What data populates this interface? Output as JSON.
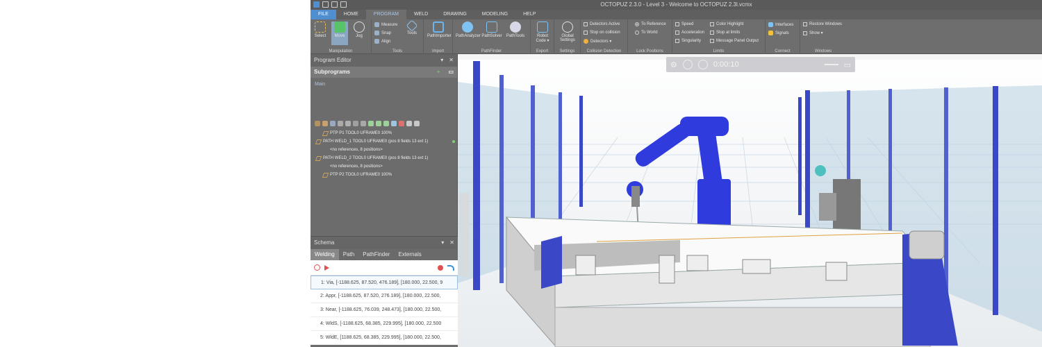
{
  "app": {
    "title": "OCTOPUZ 2.3.0 - Level 3 - Welcome to OCTOPUZ 2.3l.vcmx"
  },
  "menu": {
    "tabs": [
      "FILE",
      "HOME",
      "PROGRAM",
      "WELD",
      "DRAWING",
      "MODELING",
      "HELP"
    ],
    "active": "PROGRAM"
  },
  "ribbon": {
    "manipulation": {
      "label": "Manipulation",
      "select": "Select",
      "move": "Move",
      "jog": "Jog"
    },
    "tools": {
      "label": "Tools",
      "measure": "Measure",
      "snap": "Snap",
      "align": "Align",
      "tools": "Tools"
    },
    "import": {
      "label": "Import",
      "pathimporter": "PathImporter"
    },
    "pathfinder": {
      "label": "PathFinder",
      "analyzer": "PathAnalyzer",
      "solver": "PathSolver",
      "pathtools": "PathTools"
    },
    "export": {
      "label": "Export",
      "robotcode": "Robot Code ▾"
    },
    "settings": {
      "label": "Settings",
      "global": "Global Settings"
    },
    "collision": {
      "label": "Collision Detection",
      "active": "Detectors Active",
      "stop": "Stop on collision",
      "detectors": "Detectors ▾"
    },
    "lock": {
      "label": "Lock Positions",
      "toref": "To Reference",
      "toworld": "To World"
    },
    "limits": {
      "label": "Limits",
      "speed": "Speed",
      "accel": "Acceleration",
      "singular": "Singularity",
      "color": "Color Highlight",
      "stop": "Stop at limits",
      "msg": "Message Panel Output"
    },
    "connect": {
      "label": "Connect",
      "interfaces": "Interfaces",
      "signals": "Signals"
    },
    "windows": {
      "label": "Windows",
      "restore": "Restore Windows",
      "show": "Show ▾"
    }
  },
  "program_editor": {
    "title": "Program Editor",
    "subprograms": "Subprograms",
    "main": "Main",
    "tree": [
      {
        "text": "PTP P1 TOOL0 UFRAME0 100%",
        "indent": 1
      },
      {
        "text": "PATH WELD_1 TOOL0 UFRAME0 (pos 8 fields 13 ext 1)",
        "indent": 0,
        "dot": true
      },
      {
        "text": "<no references, 8 positions>",
        "indent": 2
      },
      {
        "text": "PATH WELD_2 TOOL0 UFRAME0 (pos 8 fields 13 ext 1)",
        "indent": 0
      },
      {
        "text": "<no references, 8 positions>",
        "indent": 2
      },
      {
        "text": "PTP P2 TOOL0 UFRAME0 100%",
        "indent": 1
      }
    ]
  },
  "schema": {
    "title": "Schema",
    "tabs": [
      "Welding",
      "Path",
      "PathFinder",
      "Externals"
    ],
    "active_tab": "Welding",
    "rows": [
      "1: Via, [-1188.625, 87.520, 476.189], [180.000, 22.500, 9",
      "2: Appr, [-1188.625, 87.520, 276.189], [180.000, 22.500,",
      "3: Near, [-1188.625, 76.039, 248.473], [180.000, 22.500,",
      "4: WldS, [-1188.625, 68.385, 229.995], [180.000, 22.500",
      "5: WldE, [1188.625, 68.385, 229.995], [180.000, 22.500,"
    ]
  },
  "viewport": {
    "time": "0:00:10"
  },
  "colors": {
    "accent": "#4f8fd0",
    "robot": "#2f3bdc",
    "frame": "#3a48c8"
  }
}
